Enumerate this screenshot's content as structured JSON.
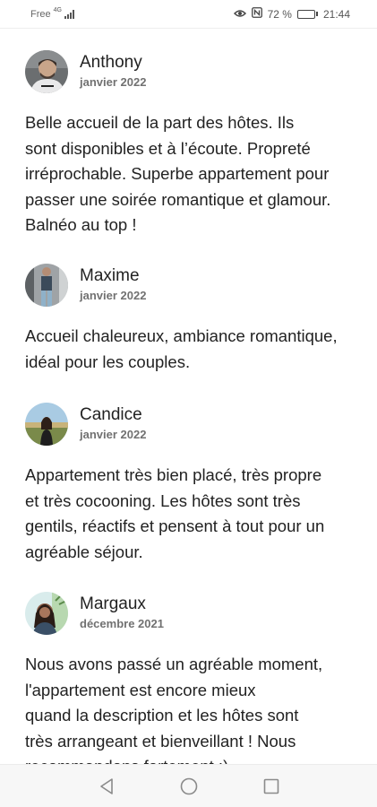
{
  "status_bar": {
    "carrier": "Free",
    "network": "4G",
    "battery": "72 %",
    "battery_level": 0.72,
    "time": "21:44",
    "icons": [
      "signal-icon",
      "eye-comfort-icon",
      "nfc-icon",
      "battery-icon"
    ]
  },
  "reviews": [
    {
      "name": "Anthony",
      "date": "janvier 2022",
      "text": "Belle accueil de la part des hôtes. Ils\nsont disponibles et à l’écoute. Propreté\nirréprochable. Superbe appartement pour\npasser une soirée romantique et glamour.\nBalnéo au top !"
    },
    {
      "name": "Maxime",
      "date": "janvier 2022",
      "text": "Accueil chaleureux, ambiance romantique,\nidéal pour les couples."
    },
    {
      "name": "Candice",
      "date": "janvier 2022",
      "text": "Appartement très bien placé, très propre\net très cocooning. Les hôtes sont très\ngentils, réactifs et pensent à tout pour un\nagréable séjour."
    },
    {
      "name": "Margaux",
      "date": "décembre 2021",
      "text": "Nous avons passé un agréable moment,\nl'appartement est encore mieux\nquand la description et les hôtes sont\ntrès arrangeant et bienveillant ! Nous\nrecommandons fortement :)"
    }
  ],
  "nav_bar": {
    "icons": [
      "back-icon",
      "home-icon",
      "recents-icon"
    ]
  }
}
